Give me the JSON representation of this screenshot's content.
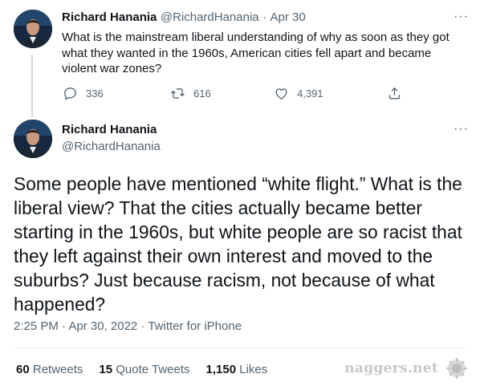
{
  "tweet1": {
    "author_name": "Richard Hanania",
    "handle": "@RichardHanania",
    "separator": "·",
    "date": "Apr 30",
    "more": "···",
    "text": "What is the mainstream liberal understanding of why as soon as they got what they wanted in the 1960s, American cities fell apart and became violent war zones?",
    "actions": {
      "reply_count": "336",
      "retweet_count": "616",
      "like_count": "4,391"
    }
  },
  "tweet2": {
    "author_name": "Richard Hanania",
    "handle": "@RichardHanania",
    "more": "···",
    "text": "Some people have mentioned “white flight.” What is the liberal view? That the cities actually became better starting in the 1960s, but white people are so racist that they left against their own interest and moved to the suburbs? Just because racism, not because of what happened?",
    "timestamp": "2:25 PM · Apr 30, 2022 · Twitter for iPhone",
    "stats": {
      "retweets_count": "60",
      "retweets_label": "Retweets",
      "quotes_count": "15",
      "quotes_label": "Quote Tweets",
      "likes_count": "1,150",
      "likes_label": "Likes"
    }
  },
  "watermark": "naggers.net",
  "colors": {
    "text": "#0f1419",
    "secondary": "#536471",
    "divider": "#eff3f4",
    "thread_line": "#cfd9de"
  }
}
